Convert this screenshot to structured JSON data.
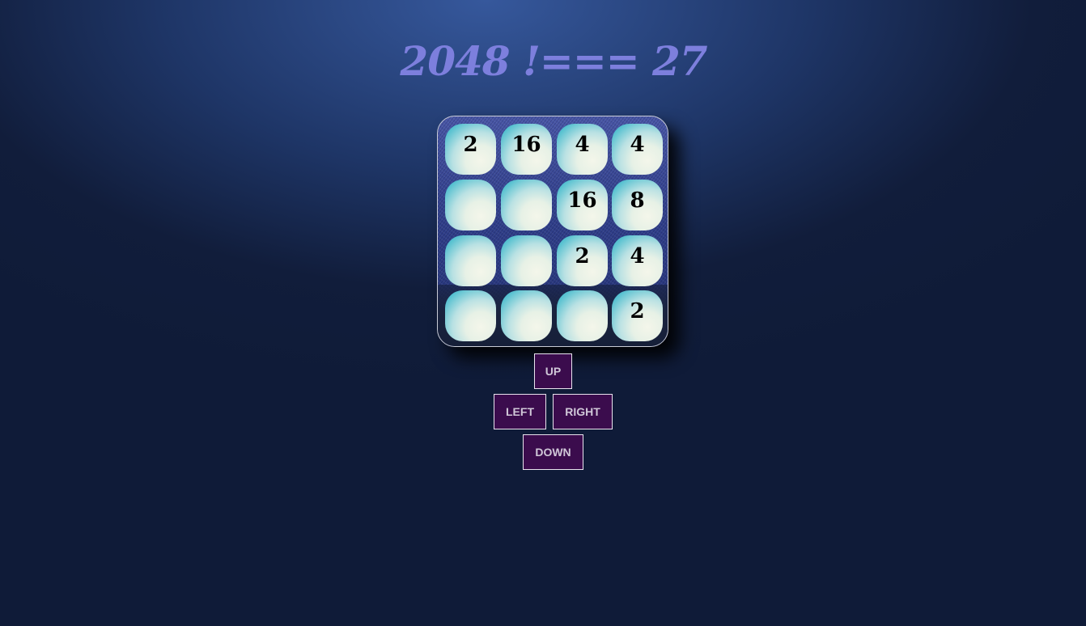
{
  "title": "2048 !=== 27",
  "board": {
    "rows": [
      [
        "2",
        "16",
        "4",
        "4"
      ],
      [
        "",
        "",
        "16",
        "8"
      ],
      [
        "",
        "",
        "2",
        "4"
      ],
      [
        "",
        "",
        "",
        "2"
      ]
    ]
  },
  "controls": {
    "up_label": "UP",
    "left_label": "LEFT",
    "right_label": "RIGHT",
    "down_label": "DOWN"
  },
  "colors": {
    "title": "#7d7fdd",
    "button_bg": "#3b0c4d",
    "button_text": "#d0c7d8",
    "page_bg": "#0f1b38"
  }
}
